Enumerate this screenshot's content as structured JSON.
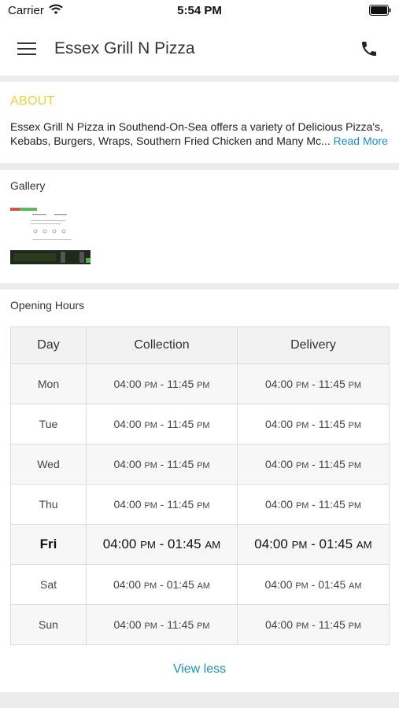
{
  "status_bar": {
    "carrier": "Carrier",
    "time": "5:54 PM"
  },
  "header": {
    "title": "Essex Grill N Pizza",
    "menu_icon": "hamburger-menu-icon",
    "call_icon": "phone-icon"
  },
  "about": {
    "heading": "ABOUT",
    "line1": "Essex Grill N Pizza in Southend-On-Sea offers a variety of Delicious Pizza's,",
    "line2": "Kebabs, Burgers, Wraps, Southern Fried Chicken and Many Mc...",
    "read_more": "Read More"
  },
  "gallery": {
    "heading": "Gallery"
  },
  "opening_hours": {
    "heading": "Opening Hours",
    "columns": [
      "Day",
      "Collection",
      "Delivery"
    ],
    "rows": [
      {
        "day": "Mon",
        "col_open": "04:00",
        "col_open_ap": "PM",
        "col_close": "11:45",
        "col_close_ap": "PM",
        "del_open": "04:00",
        "del_open_ap": "PM",
        "del_close": "11:45",
        "del_close_ap": "PM"
      },
      {
        "day": "Tue",
        "col_open": "04:00",
        "col_open_ap": "PM",
        "col_close": "11:45",
        "col_close_ap": "PM",
        "del_open": "04:00",
        "del_open_ap": "PM",
        "del_close": "11:45",
        "del_close_ap": "PM"
      },
      {
        "day": "Wed",
        "col_open": "04:00",
        "col_open_ap": "PM",
        "col_close": "11:45",
        "col_close_ap": "PM",
        "del_open": "04:00",
        "del_open_ap": "PM",
        "del_close": "11:45",
        "del_close_ap": "PM"
      },
      {
        "day": "Thu",
        "col_open": "04:00",
        "col_open_ap": "PM",
        "col_close": "11:45",
        "col_close_ap": "PM",
        "del_open": "04:00",
        "del_open_ap": "PM",
        "del_close": "11:45",
        "del_close_ap": "PM"
      },
      {
        "day": "Fri",
        "col_open": "04:00",
        "col_open_ap": "PM",
        "col_close": "01:45",
        "col_close_ap": "AM",
        "del_open": "04:00",
        "del_open_ap": "PM",
        "del_close": "01:45",
        "del_close_ap": "AM"
      },
      {
        "day": "Sat",
        "col_open": "04:00",
        "col_open_ap": "PM",
        "col_close": "01:45",
        "col_close_ap": "AM",
        "del_open": "04:00",
        "del_open_ap": "PM",
        "del_close": "01:45",
        "del_close_ap": "AM"
      },
      {
        "day": "Sun",
        "col_open": "04:00",
        "col_open_ap": "PM",
        "col_close": "11:45",
        "col_close_ap": "PM",
        "del_open": "04:00",
        "del_open_ap": "PM",
        "del_close": "11:45",
        "del_close_ap": "PM"
      }
    ],
    "view_less": "View less"
  },
  "colors": {
    "about_heading": "#e8d33b",
    "link": "#1a8fc4",
    "background": "#ececec"
  }
}
